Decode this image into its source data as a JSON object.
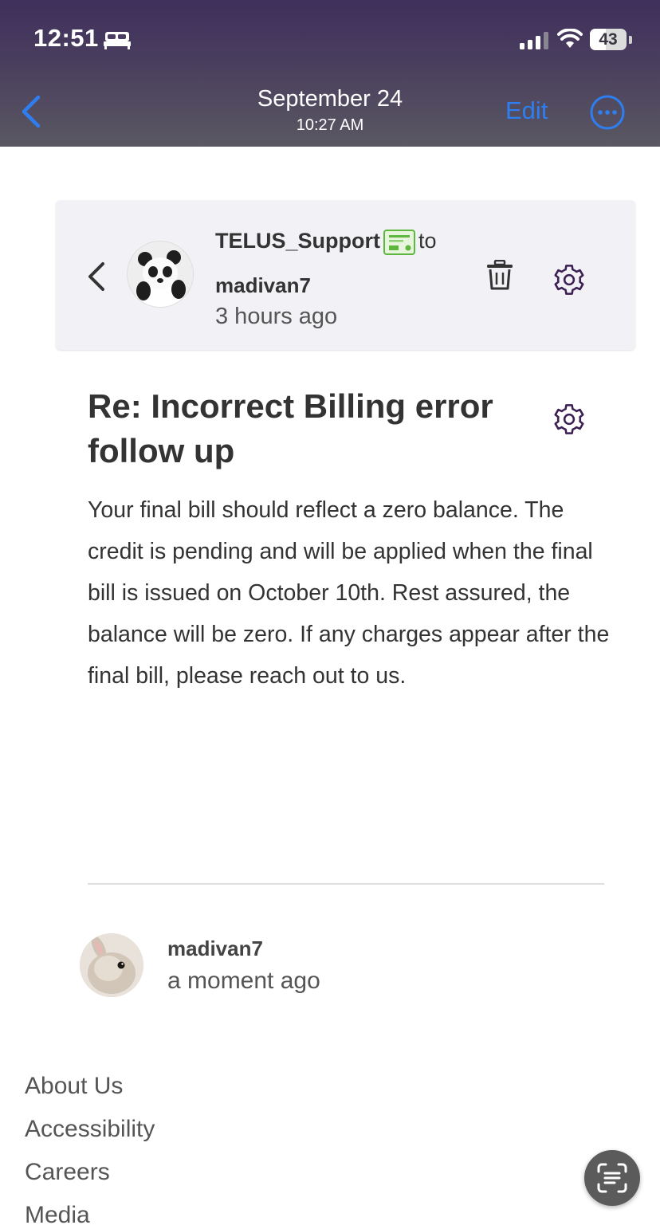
{
  "status_bar": {
    "time": "12:51",
    "battery": "43",
    "battery_level": 0.43
  },
  "nav": {
    "date": "September 24",
    "time": "10:27 AM",
    "edit_label": "Edit"
  },
  "message": {
    "sender": "TELUS_Support",
    "to_word": "to",
    "recipient": "madivan7",
    "time_ago": "3 hours ago",
    "subject": "Re: Incorrect Billing error follow up",
    "body": "Your final bill should reflect a zero balance. The credit is pending and will be applied when the final bill is issued on October 10th. Rest assured, the balance will be zero. If any charges appear after the final bill, please reach out to us."
  },
  "reply": {
    "user": "madivan7",
    "time_ago": "a moment ago"
  },
  "footer": {
    "links": [
      "About Us",
      "Accessibility",
      "Careers",
      "Media"
    ]
  },
  "icons": {
    "accent": "#2f7ef0",
    "gear_color": "#3b1f52"
  }
}
